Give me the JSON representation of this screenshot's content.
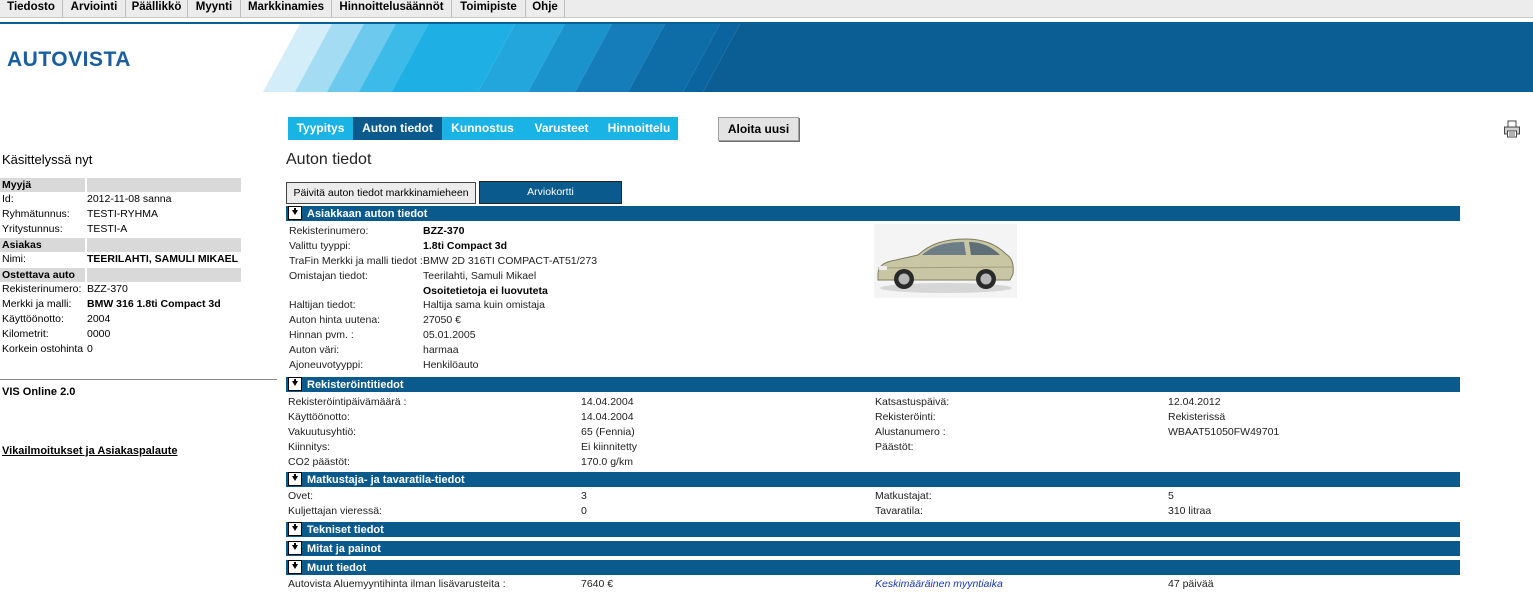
{
  "menu": [
    "Tiedosto",
    "Arviointi",
    "Päällikkö",
    "Myynti",
    "Markkinamies",
    "Hinnoittelusäännöt",
    "Toimipiste",
    "Ohje"
  ],
  "brand": {
    "logo": "AUTOVISTA"
  },
  "tabs": [
    "Tyypitys",
    "Auton tiedot",
    "Kunnostus",
    "Varusteet",
    "Hinnoittelu"
  ],
  "new_button": "Aloita uusi",
  "left": {
    "title": "Käsittelyssä nyt",
    "seller_header": "Myyjä",
    "id_label": "Id:",
    "id_value": "2012-11-08 sanna",
    "group_label": "Ryhmätunnus:",
    "group_value": "TESTI-RYHMA",
    "company_label": "Yritystunnus:",
    "company_value": "TESTI-A",
    "customer_header": "Asiakas",
    "name_label": "Nimi:",
    "name_value": "TEERILAHTI, SAMULI MIKAEL",
    "car_header": "Ostettava auto",
    "reg_label": "Rekisterinumero:",
    "reg_value": "BZZ-370",
    "model_label": "Merkki ja malli:",
    "model_value": "BMW 316 1.8ti Compact 3d",
    "first_use_label": "Käyttöönotto:",
    "first_use_value": "2004",
    "km_label": "Kilometrit:",
    "km_value": "0000",
    "max_price_label": "Korkein ostohinta",
    "max_price_value": "0",
    "vis_label": "VIS Online 2.0",
    "feedback_link": "Vikailmoitukset ja Asiakaspalaute"
  },
  "main": {
    "title": "Auton tiedot",
    "update_button": "Päivitä auton tiedot markkinamieheen",
    "card_button": "Arviokortti",
    "sections": {
      "customer_car": "Asiakkaan auton tiedot",
      "registration": "Rekisteröintitiedot",
      "passenger": "Matkustaja- ja tavaratila-tiedot",
      "technical": "Tekniset tiedot",
      "dimensions": "Mitat ja painot",
      "other": "Muut tiedot"
    },
    "car": {
      "reg_label": "Rekisterinumero:",
      "reg_value": "BZZ-370",
      "type_label": "Valittu tyyppi:",
      "type_value": "1.8ti Compact 3d",
      "trafin_label": "TraFin Merkki ja malli tiedot :",
      "trafin_value": "BMW 2D 316TI COMPACT-AT51/273",
      "owner_label": "Omistajan tiedot:",
      "owner_value": "Teerilahti, Samuli Mikael",
      "owner_note": "Osoitetietoja ei luovuteta",
      "holder_label": "Haltijan tiedot:",
      "holder_value": "Haltija sama kuin omistaja",
      "price_new_label": "Auton hinta uutena:",
      "price_new_value": "27050 €",
      "price_date_label": "Hinnan pvm. :",
      "price_date_value": "05.01.2005",
      "color_label": "Auton väri:",
      "color_value": "harmaa",
      "vehicle_type_label": "Ajoneuvotyyppi:",
      "vehicle_type_value": "Henkilöauto"
    },
    "registration": {
      "reg_date_label": "Rekisteröintipäivämäärä :",
      "reg_date_value": "14.04.2004",
      "first_use_label": "Käyttöönotto:",
      "first_use_value": "14.04.2004",
      "insurance_label": "Vakuutusyhtiö:",
      "insurance_value": "65 (Fennia)",
      "lien_label": "Kiinnitys:",
      "lien_value": "Ei kiinnitetty",
      "co2_label": "CO2 päästöt:",
      "co2_value": "170.0 g/km",
      "inspection_label": "Katsastuspäivä:",
      "inspection_value": "12.04.2012",
      "registration_label": "Rekisteröinti:",
      "registration_value": "Rekisterissä",
      "vin_label": "Alustanumero :",
      "vin_value": "WBAAT51050FW49701",
      "emissions_label": "Päästöt:"
    },
    "passenger": {
      "doors_label": "Ovet:",
      "doors_value": "3",
      "beside_label": "Kuljettajan vieressä:",
      "beside_value": "0",
      "passengers_label": "Matkustajat:",
      "passengers_value": "5",
      "cargo_label": "Tavaratila:",
      "cargo_value": "310 litraa"
    },
    "other": {
      "area_price_label": "Autovista Aluemyyntihinta ilman lisävarusteita :",
      "area_price_value": "7640 €",
      "avg_time_label": "Keskimääräinen myyntiaika",
      "avg_time_value": "47 päivää"
    }
  }
}
